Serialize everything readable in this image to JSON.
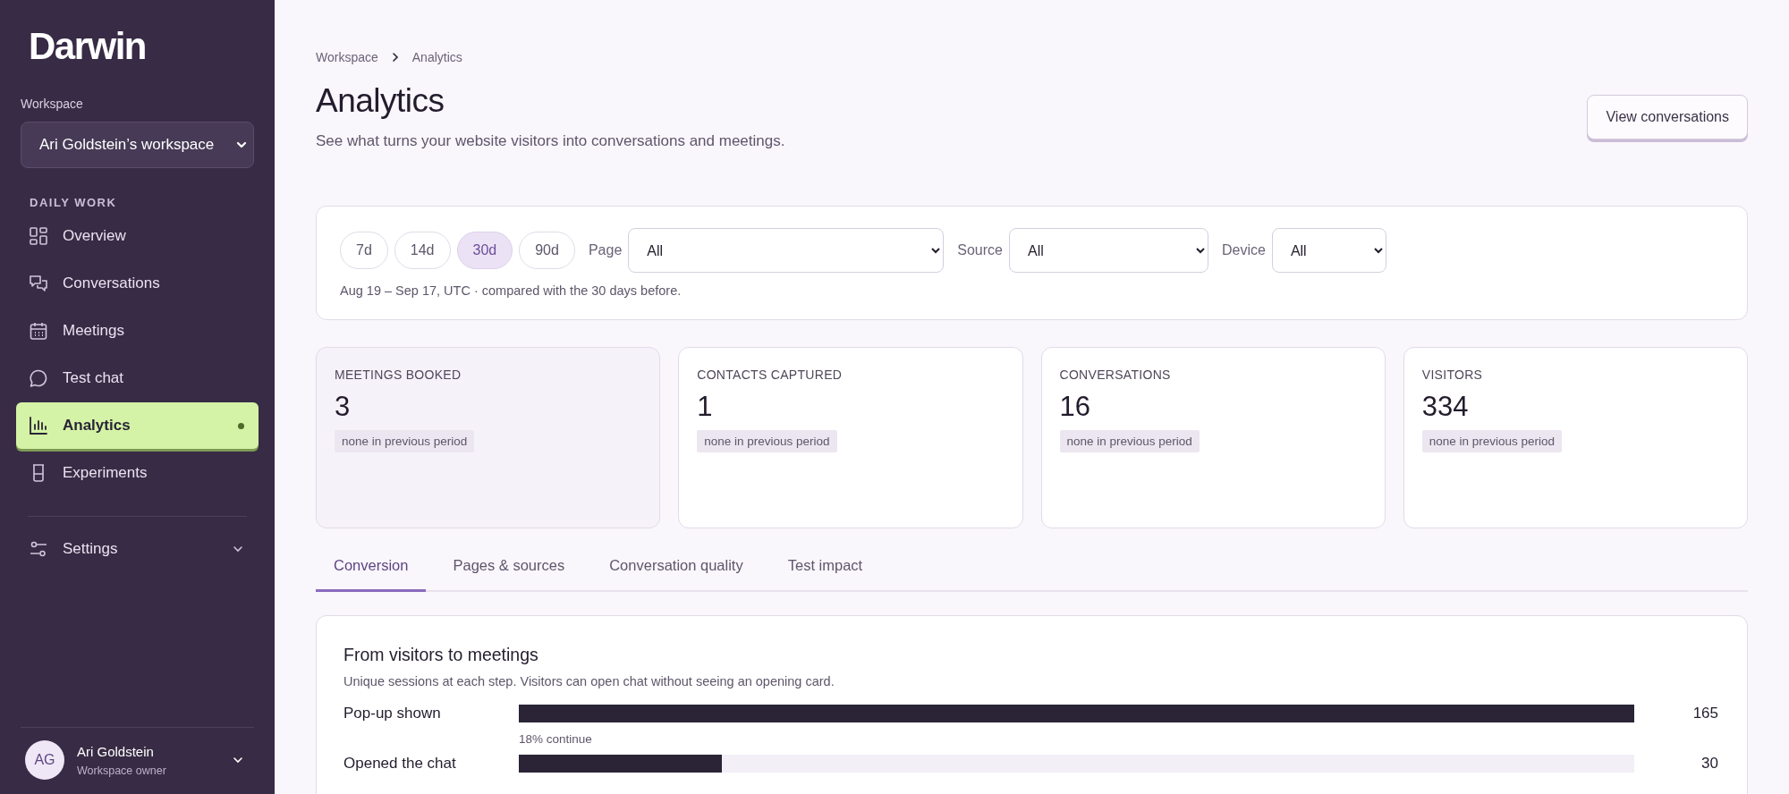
{
  "sidebar": {
    "logo": "Darwin",
    "workspace_label": "Workspace",
    "workspace_select": {
      "value": "Ari Goldstein’s workspace"
    },
    "section_title": "DAILY WORK",
    "items": [
      {
        "label": "Overview",
        "selected": false
      },
      {
        "label": "Conversations",
        "selected": false
      },
      {
        "label": "Meetings",
        "selected": false
      },
      {
        "label": "Test chat",
        "selected": false
      },
      {
        "label": "Analytics",
        "selected": true
      },
      {
        "label": "Experiments",
        "selected": false
      }
    ],
    "settings": {
      "label": "Settings"
    },
    "user": {
      "initials": "AG",
      "name": "Ari Goldstein",
      "role": "Workspace owner"
    }
  },
  "breadcrumb": [
    "Workspace",
    "Analytics"
  ],
  "header": {
    "title": "Analytics",
    "subtitle": "See what turns your website visitors into conversations and meetings.",
    "button": "View conversations"
  },
  "filters": {
    "ranges": [
      {
        "label": "7d",
        "selected": false
      },
      {
        "label": "14d",
        "selected": false
      },
      {
        "label": "30d",
        "selected": true
      },
      {
        "label": "90d",
        "selected": false
      }
    ],
    "selects": [
      {
        "label": "Page",
        "value": "All"
      },
      {
        "label": "Source",
        "value": "All"
      },
      {
        "label": "Device",
        "value": "All"
      }
    ],
    "note": "Aug 19 – Sep 17, UTC · compared with the 30 days before."
  },
  "metrics": [
    {
      "label": "MEETINGS BOOKED",
      "value": "3",
      "change": "none in previous period",
      "selected": true
    },
    {
      "label": "CONTACTS CAPTURED",
      "value": "1",
      "change": "none in previous period",
      "selected": false
    },
    {
      "label": "CONVERSATIONS",
      "value": "16",
      "change": "none in previous period",
      "selected": false
    },
    {
      "label": "VISITORS",
      "value": "334",
      "change": "none in previous period",
      "selected": false
    }
  ],
  "tabs": [
    {
      "label": "Conversion",
      "selected": true
    },
    {
      "label": "Pages & sources",
      "selected": false
    },
    {
      "label": "Conversation quality",
      "selected": false
    },
    {
      "label": "Test impact",
      "selected": false
    }
  ],
  "funnel": {
    "title": "From visitors to meetings",
    "subtitle": "Unique sessions at each step. Visitors can open chat without seeing an opening card.",
    "steps": [
      {
        "label": "Pop-up shown",
        "value": "165",
        "level": 1,
        "note": "18% continue"
      },
      {
        "label": "Opened the chat",
        "value": "30",
        "level": 0.182
      }
    ]
  }
}
